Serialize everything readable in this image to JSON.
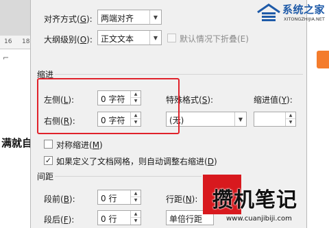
{
  "document_background": {
    "ruler_numbers": [
      "16",
      "18"
    ],
    "body_text": "满就自"
  },
  "general": {
    "alignment": {
      "label": "对齐方式(",
      "key": "G",
      "suffix": "):",
      "value": "两端对齐"
    },
    "outline_level": {
      "label": "大纲级别(",
      "key": "O",
      "suffix": "):",
      "value": "正文文本"
    },
    "collapse_default": {
      "label": "默认情况下折叠(E)",
      "checked": false,
      "enabled": false
    }
  },
  "indent": {
    "title": "缩进",
    "left": {
      "label": "左侧(",
      "key": "L",
      "suffix": "):",
      "value": "0 字符"
    },
    "right": {
      "label": "右侧(",
      "key": "R",
      "suffix": "):",
      "value": "0 字符"
    },
    "special": {
      "label": "特殊格式(",
      "key": "S",
      "suffix": "):",
      "value": "(无)"
    },
    "by": {
      "label": "缩进值(",
      "key": "Y",
      "suffix": "):",
      "value": ""
    },
    "mirror": {
      "label": "对称缩进(",
      "key": "M",
      "suffix": ")",
      "checked": false
    },
    "auto_adjust": {
      "label": "如果定义了文档网格，则自动调整右缩进(",
      "key": "D",
      "suffix": ")",
      "checked": true
    }
  },
  "spacing": {
    "title": "间距",
    "before": {
      "label": "段前(",
      "key": "B",
      "suffix": "):",
      "value": "0 行"
    },
    "after": {
      "label": "段后(",
      "key": "F",
      "suffix": "):",
      "value": "0 行"
    },
    "line": {
      "label": "行距(",
      "key": "N",
      "suffix": "):",
      "value": "单倍行距"
    }
  },
  "watermarks": {
    "top_name": "系统之家",
    "top_domain": "XITONGZHIJIA.NET",
    "bottom_name": "攒机笔记",
    "bottom_url": "www.cuanjibiji.com"
  },
  "colors": {
    "highlight": "#e0212a",
    "brand_blue": "#1e5aa8",
    "brand_red": "#d8191e"
  }
}
